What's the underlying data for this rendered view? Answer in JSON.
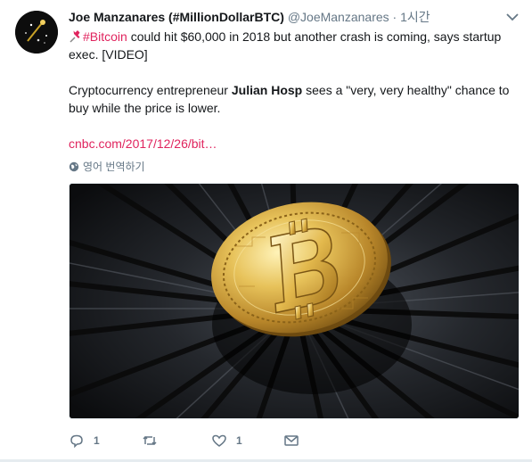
{
  "tweet": {
    "display_name": "Joe Manzanares (#MillionDollarBTC)",
    "handle": "@JoeManzanares",
    "separator": "·",
    "time": "1시간",
    "hashtag": "#Bitcoin",
    "line1_rest": " could hit $60,000 in 2018 but another crash is coming, says startup exec. [VIDEO]",
    "para2_before": "Cryptocurrency entrepreneur ",
    "para2_bold": "Julian Hosp",
    "para2_after": " sees a \"very, very healthy\" chance to buy while the price is lower.",
    "link": "cnbc.com/2017/12/26/bit…",
    "translate_label": "영어 번역하기"
  },
  "actions": {
    "reply_count": "1",
    "retweet_count": "",
    "like_count": "1"
  },
  "colors": {
    "accent": "#e0245e",
    "muted": "#657786",
    "text": "#14171a"
  },
  "icons": [
    "pin-icon",
    "globe-icon",
    "caret-down-icon",
    "reply-icon",
    "retweet-icon",
    "heart-icon",
    "envelope-icon"
  ]
}
